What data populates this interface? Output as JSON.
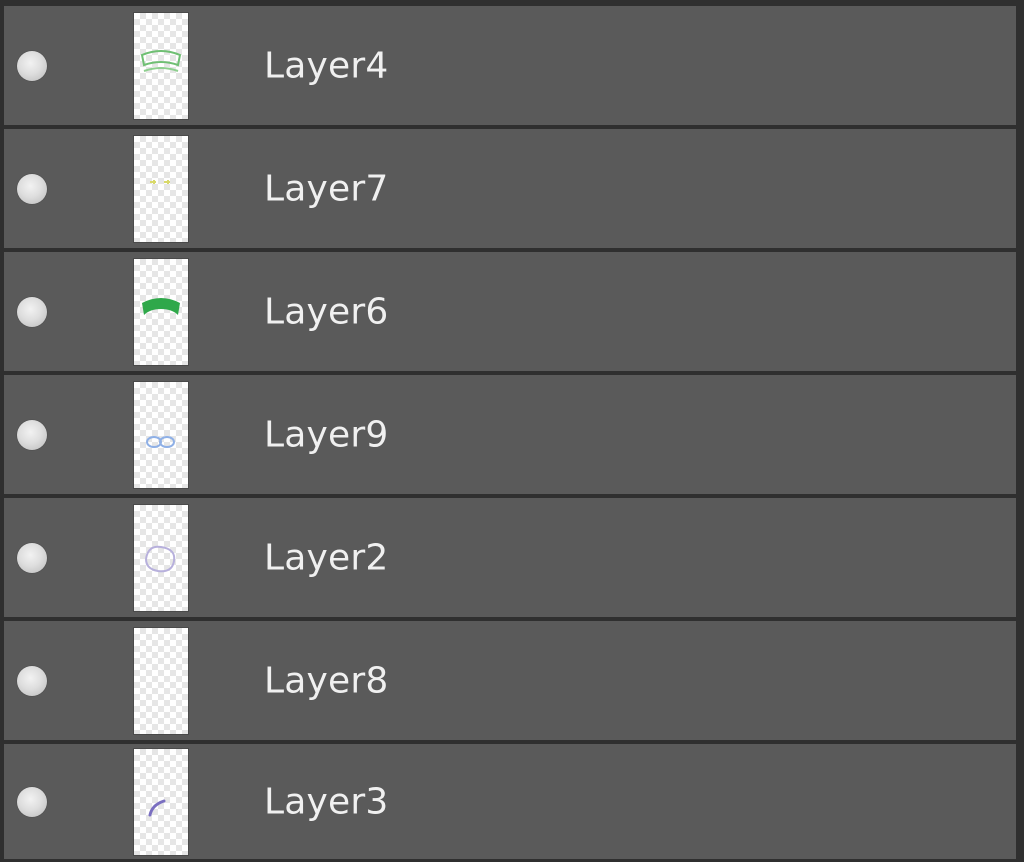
{
  "layers_panel": {
    "layers": [
      {
        "name": "Layer4",
        "visible": true,
        "thumbnail_icon": "thumb-green-outline-arc",
        "thumbnail_color": "#6fbf73"
      },
      {
        "name": "Layer7",
        "visible": true,
        "thumbnail_icon": "thumb-yellow-dots",
        "thumbnail_color": "#d9d96a"
      },
      {
        "name": "Layer6",
        "visible": true,
        "thumbnail_icon": "thumb-green-solid-shape",
        "thumbnail_color": "#2fa84a"
      },
      {
        "name": "Layer9",
        "visible": true,
        "thumbnail_icon": "thumb-blue-loops",
        "thumbnail_color": "#8fb0e6"
      },
      {
        "name": "Layer2",
        "visible": true,
        "thumbnail_icon": "thumb-lavender-circle",
        "thumbnail_color": "#b7b0dc"
      },
      {
        "name": "Layer8",
        "visible": true,
        "thumbnail_icon": "thumb-empty",
        "thumbnail_color": "#ffffff"
      },
      {
        "name": "Layer3",
        "visible": true,
        "thumbnail_icon": "thumb-purple-arc",
        "thumbnail_color": "#7a6fc0"
      }
    ]
  }
}
